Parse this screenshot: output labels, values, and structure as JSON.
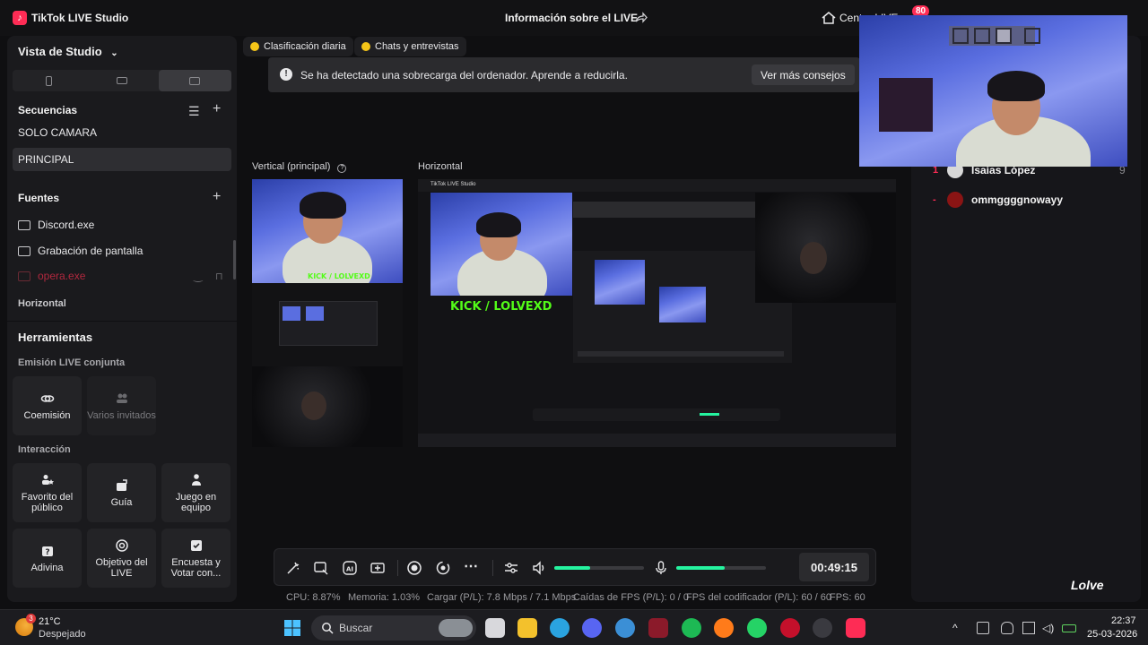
{
  "titlebar": {
    "app_name": "TikTok LIVE Studio",
    "live_info": "Información sobre el LIVE",
    "center_label": "Centro LIVE",
    "notif_count": "80"
  },
  "left_panel": {
    "studio_view": "Vista de Studio",
    "sequences_title": "Secuencias",
    "sequences": [
      "SOLO CAMARA",
      "PRINCIPAL"
    ],
    "sources_title": "Fuentes",
    "sources": [
      "Discord.exe",
      "Grabación de pantalla",
      "opera.exe"
    ],
    "horizontal_label": "Horizontal",
    "tools_title": "Herramientas",
    "joint_live_label": "Emisión LIVE conjunta",
    "joint_tools": [
      {
        "label": "Coemisión",
        "icon": "link-icon"
      },
      {
        "label": "Varios invitados",
        "icon": "guests-icon"
      }
    ],
    "interaction_label": "Interacción",
    "interaction_tools": [
      {
        "label": "Favorito del público",
        "icon": "fans-icon"
      },
      {
        "label": "Guía",
        "icon": "guide-icon"
      },
      {
        "label": "Juego en equipo",
        "icon": "team-game-icon"
      },
      {
        "label": "Adivina",
        "icon": "guess-icon"
      },
      {
        "label": "Objetivo del LIVE",
        "icon": "goal-icon"
      },
      {
        "label": "Encuesta y Votar con...",
        "icon": "poll-icon"
      }
    ]
  },
  "chips": {
    "daily_ranking": "Clasificación diaria",
    "chats": "Chats y entrevistas"
  },
  "warning": {
    "text": "Se ha detectado una sobrecarga del ordenador. Aprende a reducirla.",
    "button": "Ver más consejos"
  },
  "previews": {
    "vertical_label": "Vertical (principal)",
    "horizontal_label": "Horizontal",
    "overlay_text": "KICK / LOLVEXD"
  },
  "controls": {
    "timer": "00:49:15",
    "volume_level": 0.4,
    "mic_level": 0.54
  },
  "stats": {
    "cpu": "CPU:  8.87%",
    "memory": "Memoria:  1.03%",
    "upload": "Cargar (P/L):  7.8 Mbps / 7.1 Mbps",
    "fps_drop": "Caídas de FPS (P/L):  0 / 0",
    "encoder_fps": "FPS del codificador (P/L):  60 / 60",
    "fps": "FPS:  60"
  },
  "viewers": [
    {
      "rank": "1",
      "name": "Isaías López",
      "score": "9"
    },
    {
      "rank": "-",
      "name": "ommggggnowayy",
      "score": ""
    }
  ],
  "watermark": "Lolve",
  "taskbar": {
    "temperature": "21°C",
    "weather": "Despejado",
    "weather_badge": "3",
    "search_placeholder": "Buscar",
    "time": "22:37",
    "date": "25-03-2026"
  },
  "colors": {
    "accent": "#fe2c55",
    "live_green": "#25f4a0",
    "kick_green": "#53fc18"
  }
}
